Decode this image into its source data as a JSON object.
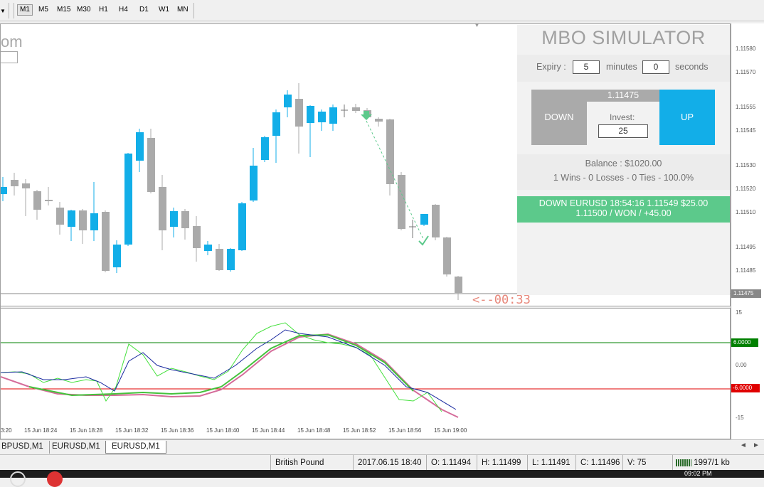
{
  "toolbar": {
    "timeframes": [
      "M1",
      "M5",
      "M15",
      "M30",
      "H1",
      "H4",
      "D1",
      "W1",
      "MN"
    ],
    "active_timeframe": "M1"
  },
  "chart": {
    "watermark_fragment": "om",
    "timer": "<--00:33",
    "price_axis": [
      "1.11580",
      "1.11570",
      "1.11555",
      "1.11545",
      "1.11530",
      "1.11520",
      "1.11510",
      "1.11495",
      "1.11485",
      "1.11475"
    ],
    "current_price_label": "1.11475",
    "time_axis": [
      "3:20",
      "15 Jun 18:24",
      "15 Jun 18:28",
      "15 Jun 18:32",
      "15 Jun 18:36",
      "15 Jun 18:40",
      "15 Jun 18:44",
      "15 Jun 18:48",
      "15 Jun 18:52",
      "15 Jun 18:56",
      "15 Jun 19:00"
    ],
    "indicator_axis": [
      "15",
      "6.0000",
      "0.00",
      "-6.0000",
      "-15"
    ],
    "colors": {
      "bull": "#12aee8",
      "bear": "#aaaaaa",
      "upper_level": "#008000",
      "lower_level": "#e00000"
    }
  },
  "simulator": {
    "title": "MBO SIMULATOR",
    "expiry_label": "Expiry :",
    "expiry_minutes": "5",
    "minutes_label": "minutes",
    "expiry_seconds": "0",
    "seconds_label": "seconds",
    "down_label": "DOWN",
    "up_label": "UP",
    "current_price": "1.11475",
    "invest_label": "Invest:",
    "invest_value": "25",
    "balance": "Balance : $1020.00",
    "stats": "1 Wins - 0 Losses - 0 Ties - 100.0%",
    "trade_line1": "DOWN EURUSD 18:54:16 1.11549 $25.00",
    "trade_line2": "1.11500 / WON / +45.00",
    "colors": {
      "down": "#aaaaaa",
      "up": "#12aee8",
      "win": "#5cc98b"
    }
  },
  "tabs": [
    "BPUSD,M1",
    "EURUSD,M1",
    "EURUSD,M1"
  ],
  "active_tab": 2,
  "status": {
    "symbol": "British Pound",
    "datetime": "2017.06.15 18:40",
    "open": "O: 1.11494",
    "high": "H: 1.11499",
    "low": "L: 1.11491",
    "close": "C: 1.11496",
    "volume": "V: 75",
    "traffic": "1997/1 kb"
  },
  "taskbar": {
    "clock": "09:02 PM"
  }
}
